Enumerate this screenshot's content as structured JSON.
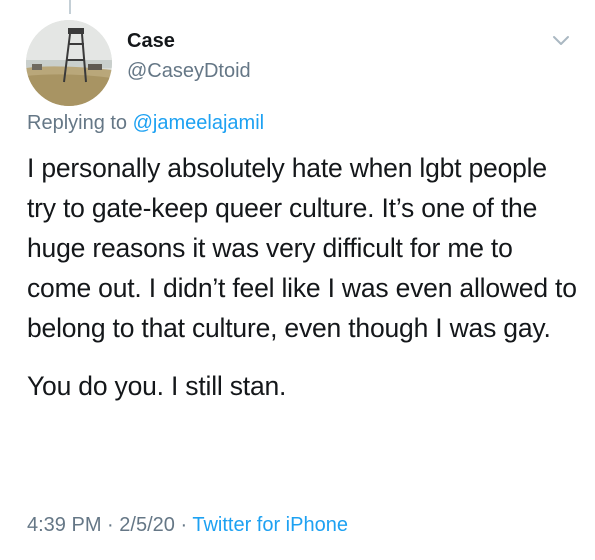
{
  "author": {
    "display_name": "Case",
    "handle": "@CaseyDtoid"
  },
  "reply": {
    "prefix": "Replying to",
    "mention": "@jameelajamil"
  },
  "tweet": {
    "paragraphs": [
      "I personally absolutely hate when lgbt people try to gate-keep queer culture. It’s one of the huge reasons it was very difficult for me to come out. I didn’t feel like I was even allowed to belong to that culture, even though I was gay.",
      "You do you. I still stan."
    ]
  },
  "meta": {
    "time": "4:39 PM",
    "separator": "·",
    "date": "2/5/20",
    "source": "Twitter for iPhone"
  },
  "icons": {
    "menu": "chevron-down-icon",
    "avatar": "profile-photo"
  },
  "colors": {
    "text": "#14171a",
    "secondary": "#657786",
    "accent": "#1da1f2"
  }
}
